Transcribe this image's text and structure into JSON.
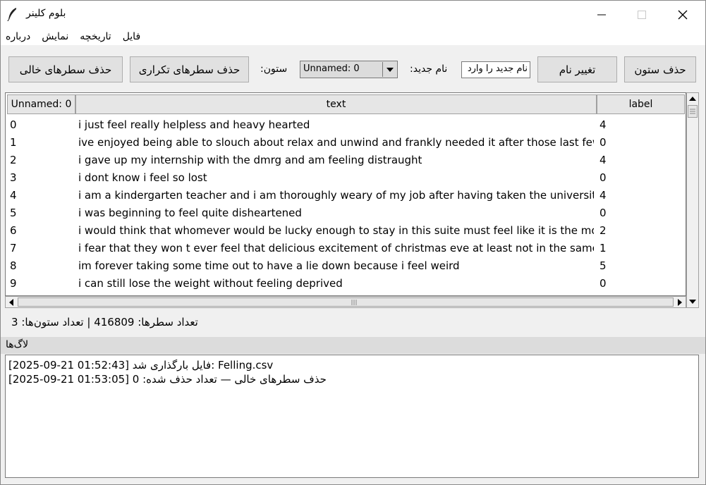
{
  "window": {
    "title": "بلوم کلینر",
    "icons": {
      "app": "feather-icon",
      "minimize": "minimize-icon",
      "maximize": "maximize-icon",
      "close": "close-icon"
    }
  },
  "menu": [
    "فایل",
    "تاریخچه",
    "نمایش",
    "درباره"
  ],
  "toolbar": {
    "remove_empty_rows": "حذف سطرهای خالی",
    "remove_duplicate_rows": "حذف سطرهای تکراری",
    "column_label": ":ستون",
    "column_select_value": "Unnamed: 0",
    "new_name_label": ":نام جدید",
    "new_name_placeholder": "نام جدید را وارد",
    "rename_button": "تغییر نام",
    "delete_column_button": "حذف ستون"
  },
  "table": {
    "columns": [
      "Unnamed: 0",
      "text",
      "label"
    ],
    "rows": [
      [
        "0",
        "i just feel really helpless and heavy hearted",
        "4"
      ],
      [
        "1",
        "ive enjoyed being able to slouch about relax and unwind and frankly needed it after those last few weeks",
        "0"
      ],
      [
        "2",
        "i gave up my internship with the dmrg and am feeling distraught",
        "4"
      ],
      [
        "3",
        "i dont know i feel so lost",
        "0"
      ],
      [
        "4",
        "i am a kindergarten teacher and i am thoroughly weary of my job after having taken the university entrance exam",
        "4"
      ],
      [
        "5",
        "i was beginning to feel quite disheartened",
        "0"
      ],
      [
        "6",
        "i would think that whomever would be lucky enough to stay in this suite must feel like it is the most romantic",
        "2"
      ],
      [
        "7",
        "i fear that they won t ever feel that delicious excitement of christmas eve at least not in the same way i do",
        "1"
      ],
      [
        "8",
        "im forever taking some time out to have a lie down because i feel weird",
        "5"
      ],
      [
        "9",
        "i can still lose the weight without feeling deprived",
        "0"
      ]
    ]
  },
  "status": "تعداد سطرها: 416809 | تعداد ستون‌ها: 3",
  "logs": {
    "title": "لاگ‌ها",
    "lines": [
      "[2025-09-21 01:52:43] فایل بارگذاری شد: Felling.csv",
      "[2025-09-21 01:53:05] حذف سطرهای خالی — تعداد حذف شده: 0"
    ]
  }
}
